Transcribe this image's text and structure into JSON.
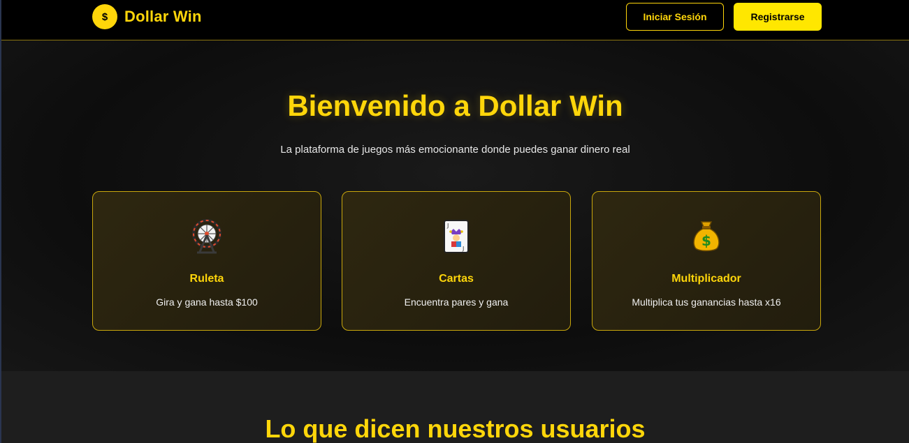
{
  "header": {
    "brand_symbol": "$",
    "brand_name": "Dollar Win",
    "login_label": "Iniciar Sesión",
    "register_label": "Registrarse"
  },
  "hero": {
    "title": "Bienvenido a Dollar Win",
    "subtitle": "La plataforma de juegos más emocionante donde puedes ganar dinero real"
  },
  "games": [
    {
      "icon": "ferris-wheel-icon",
      "title": "Ruleta",
      "description": "Gira y gana hasta $100"
    },
    {
      "icon": "joker-card-icon",
      "title": "Cartas",
      "description": "Encuentra pares y gana"
    },
    {
      "icon": "money-bag-icon",
      "title": "Multiplicador",
      "description": "Multiplica tus ganancias hasta x16"
    }
  ],
  "testimonials": {
    "title": "Lo que dicen nuestros usuarios"
  },
  "colors": {
    "accent": "#FFD60A",
    "background": "#0d0d0d",
    "card_border": "#c9a70c"
  }
}
